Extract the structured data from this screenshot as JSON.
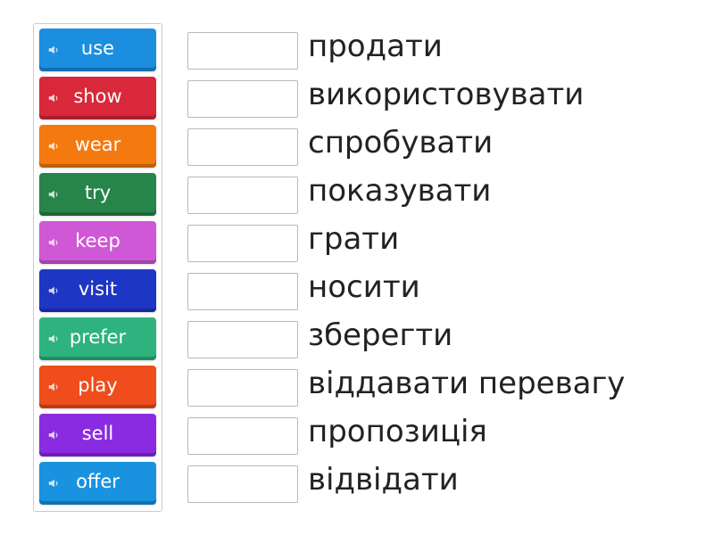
{
  "words": [
    {
      "label": "use",
      "color": "#1b8ee0"
    },
    {
      "label": "show",
      "color": "#d8283a"
    },
    {
      "label": "wear",
      "color": "#f47a10"
    },
    {
      "label": "try",
      "color": "#27854a"
    },
    {
      "label": "keep",
      "color": "#cf58d6"
    },
    {
      "label": "visit",
      "color": "#1e36c4"
    },
    {
      "label": "prefer",
      "color": "#2fb37e"
    },
    {
      "label": "play",
      "color": "#ef4d1c"
    },
    {
      "label": "sell",
      "color": "#8a2be2"
    },
    {
      "label": "offer",
      "color": "#1993e0"
    }
  ],
  "targets": [
    "продати",
    "використовувати",
    "спробувати",
    "показувати",
    "грати",
    "носити",
    "зберегти",
    "віддавати перевагу",
    "пропозиція",
    "відвідати"
  ],
  "icons": {
    "tile_icon": "speaker-icon"
  }
}
